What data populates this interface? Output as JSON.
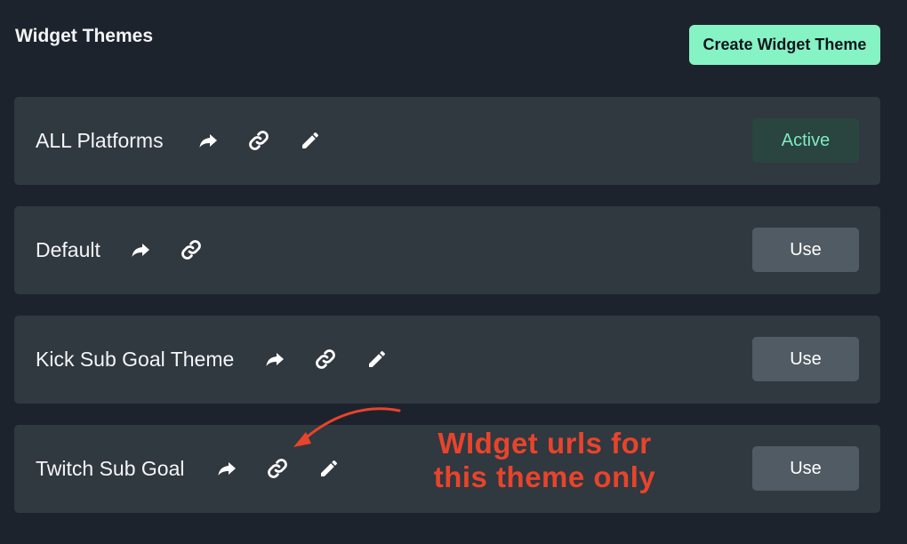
{
  "header": {
    "title": "Widget Themes",
    "create_label": "Create Widget Theme"
  },
  "themes": [
    {
      "name": "ALL Platforms",
      "icons": [
        "share-icon",
        "link-icon",
        "pencil-icon"
      ],
      "action_label": "Active",
      "action_state": "active"
    },
    {
      "name": "Default",
      "icons": [
        "share-icon",
        "link-icon"
      ],
      "action_label": "Use",
      "action_state": "use"
    },
    {
      "name": "Kick Sub Goal Theme",
      "icons": [
        "share-icon",
        "link-icon",
        "pencil-icon"
      ],
      "action_label": "Use",
      "action_state": "use"
    },
    {
      "name": "Twitch Sub Goal",
      "icons": [
        "share-icon",
        "link-icon",
        "pencil-icon"
      ],
      "action_label": "Use",
      "action_state": "use"
    }
  ],
  "annotation": {
    "line1": "WIdget urls for",
    "line2": "this theme only"
  },
  "colors": {
    "background": "#1d232d",
    "card": "#303840",
    "accent": "#86f3c5",
    "active_text": "#7eebc0",
    "annotation": "#e8442b"
  }
}
